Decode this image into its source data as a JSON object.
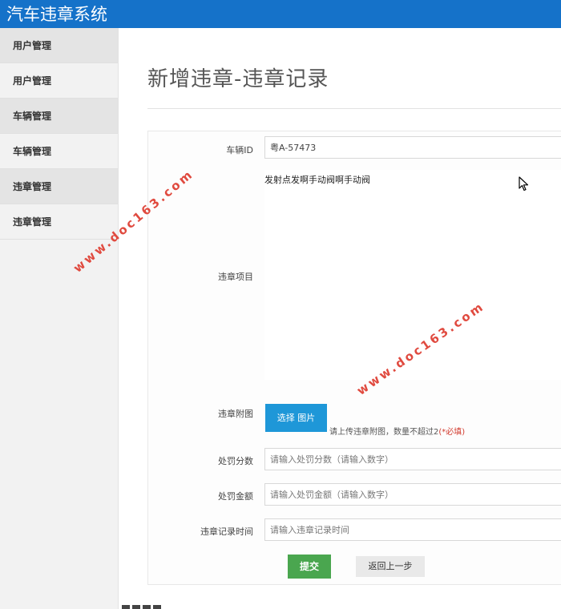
{
  "app": {
    "title": "汽车违章系统"
  },
  "sidebar": {
    "items": [
      {
        "label": "用户管理",
        "type": "group"
      },
      {
        "label": "用户管理",
        "type": "link"
      },
      {
        "label": "车辆管理",
        "type": "group"
      },
      {
        "label": "车辆管理",
        "type": "link"
      },
      {
        "label": "违章管理",
        "type": "group"
      },
      {
        "label": "违章管理",
        "type": "link"
      }
    ]
  },
  "page": {
    "title": "新增违章-违章记录"
  },
  "form": {
    "vehicle_id": {
      "label": "车辆ID",
      "value": "粤A-57473"
    },
    "violation_item": {
      "label": "违章项目",
      "value": "发射点发啊手动阀啊手动阀"
    },
    "attachment": {
      "label": "违章附图",
      "button_label": "选择 图片",
      "hint": "请上传违章附图，数量不超过2",
      "required": "(*必填)"
    },
    "penalty_points": {
      "label": "处罚分数",
      "placeholder": "请输入处罚分数（请输入数字）"
    },
    "penalty_amount": {
      "label": "处罚金额",
      "placeholder": "请输入处罚金额（请输入数字）"
    },
    "record_time": {
      "label": "违章记录时间",
      "placeholder": "请输入违章记录时间"
    },
    "submit_label": "提交",
    "back_label": "返回上一步"
  },
  "watermarks": [
    "www.doc163.com",
    "www.doc163.com"
  ],
  "colors": {
    "topbar": "#1572c9",
    "choose_button": "#1e97d8",
    "submit_button": "#4aa64f",
    "required": "#d23b2e",
    "watermark": "#e04a3f"
  },
  "icons": [
    "mouse-cursor-icon"
  ]
}
